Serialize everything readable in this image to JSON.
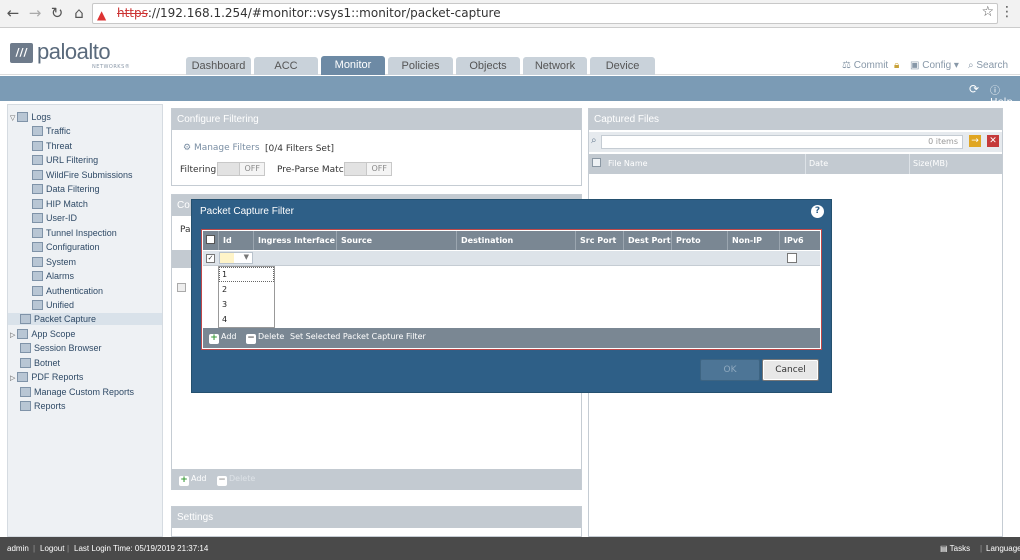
{
  "browser": {
    "back": "←",
    "forward": "→",
    "reload": "↻",
    "home": "⌂",
    "url_scheme": "https",
    "url_rest": "://192.168.1.254/#monitor::vsys1::monitor/packet-capture",
    "star": "☆",
    "menu": "⋮"
  },
  "header": {
    "logo_text": "paloalto",
    "logo_sub": "NETWORKS®",
    "tabs": [
      {
        "label": "Dashboard"
      },
      {
        "label": "ACC"
      },
      {
        "label": "Monitor"
      },
      {
        "label": "Policies"
      },
      {
        "label": "Objects"
      },
      {
        "label": "Network"
      },
      {
        "label": "Device"
      }
    ],
    "active_tab": "Monitor",
    "commit": "Commit",
    "config": "Config ▾",
    "search": "Search"
  },
  "subheader": {
    "help": "Help"
  },
  "nav": {
    "items": [
      {
        "label": "Logs"
      },
      {
        "label": "Traffic"
      },
      {
        "label": "Threat"
      },
      {
        "label": "URL Filtering"
      },
      {
        "label": "WildFire Submissions"
      },
      {
        "label": "Data Filtering"
      },
      {
        "label": "HIP Match"
      },
      {
        "label": "User-ID"
      },
      {
        "label": "Tunnel Inspection"
      },
      {
        "label": "Configuration"
      },
      {
        "label": "System"
      },
      {
        "label": "Alarms"
      },
      {
        "label": "Authentication"
      },
      {
        "label": "Unified"
      },
      {
        "label": "Packet Capture"
      },
      {
        "label": "App Scope"
      },
      {
        "label": "Session Browser"
      },
      {
        "label": "Botnet"
      },
      {
        "label": "PDF Reports"
      },
      {
        "label": "Manage Custom Reports"
      },
      {
        "label": "Reports"
      }
    ]
  },
  "filtering_panel": {
    "title": "Configure Filtering",
    "manage_filters": "Manage Filters",
    "filters_set": "[0/4 Filters Set]",
    "filtering_label": "Filtering",
    "filtering_state": "OFF",
    "preparse_label": "Pre-Parse Match",
    "preparse_state": "OFF"
  },
  "capture_panel": {
    "title_fragment": "Co",
    "row_fragment": "Pa",
    "add": "Add",
    "delete": "Delete"
  },
  "settings_panel": {
    "title": "Settings"
  },
  "captured_files": {
    "title": "Captured Files",
    "count": "0 items",
    "columns": [
      "File Name",
      "Date",
      "Size(MB)"
    ]
  },
  "modal": {
    "title": "Packet Capture Filter",
    "columns": [
      "Id",
      "Ingress Interface",
      "Source",
      "Destination",
      "Src Port",
      "Dest Port",
      "Proto",
      "Non-IP",
      "IPv6"
    ],
    "id_options": [
      "1",
      "2",
      "3",
      "4"
    ],
    "toolbar": {
      "add": "Add",
      "delete": "Delete",
      "set_selected": "Set Selected Packet Capture Filter"
    },
    "ok": "OK",
    "cancel": "Cancel"
  },
  "footer": {
    "user": "admin",
    "logout": "Logout",
    "last_login": "Last Login Time: 05/19/2019 21:37:14",
    "tasks": "Tasks",
    "language": "Language"
  }
}
